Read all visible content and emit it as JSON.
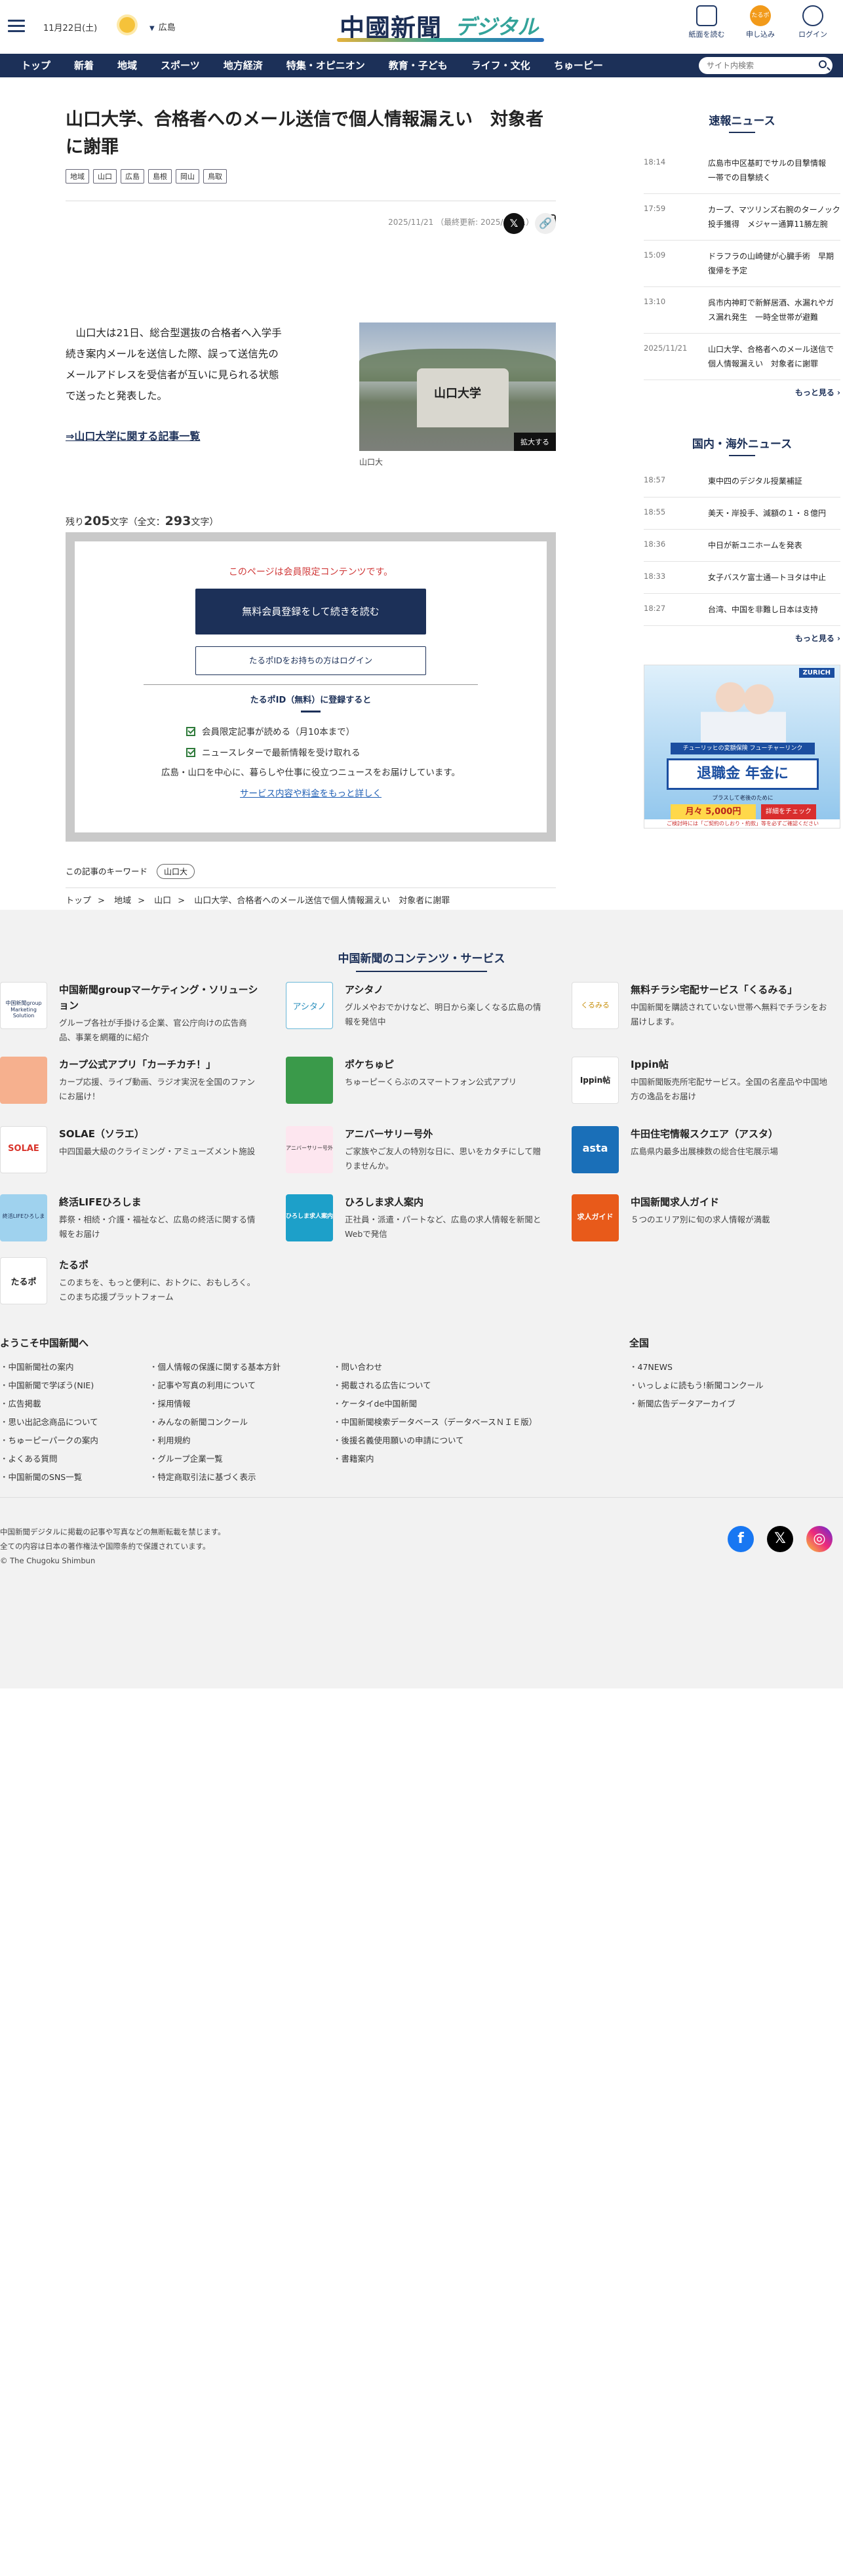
{
  "header": {
    "date": "11月22日(土)",
    "weather_icon": "sun-icon",
    "region": "広島",
    "logo_main": "中國新聞",
    "logo_sub": "デジタル",
    "btn_paper": "紙面を読む",
    "btn_apply": "申し込み",
    "btn_apply_icon": "たるポ",
    "btn_login": "ログイン"
  },
  "nav": {
    "items": [
      "トップ",
      "新着",
      "地域",
      "スポーツ",
      "地方経済",
      "特集・オピニオン",
      "教育・子ども",
      "ライフ・文化",
      "ちゅーピー"
    ],
    "search_placeholder": "サイト内検索"
  },
  "article": {
    "headline": "山口大学、合格者へのメール送信で個人情報漏えい　対象者に謝罪",
    "tags": [
      "地域",
      "山口",
      "広島",
      "島根",
      "岡山",
      "鳥取"
    ],
    "date": "2025/11/21",
    "updated": "（最終更新: 2025/11/21）",
    "lead": "　山口大は21日、総合型選抜の合格者へ入学手続き案内メールを送信した際、誤って送信先のメールアドレスを受信者が互いに見られる状態で送ったと発表した。",
    "related_link": "⇒山口大学に関する記事一覧",
    "photo_sign": "山口大学",
    "photo_expand": "拡大する",
    "photo_caption": "山口大",
    "remain_prefix": "残り",
    "remain_count": "205",
    "remain_suffix": "文字（全文：",
    "total_count": "293",
    "total_suffix": "文字）",
    "keyword_label": "この記事のキーワード",
    "keyword": "山口大"
  },
  "paywall": {
    "message": "このページは会員限定コンテンツです。",
    "primary_button": "無料会員登録をして続きを読む",
    "secondary_button": "たるポIDをお持ちの方はログイン",
    "register_title": "たるポID（無料）に登録すると",
    "benefits": [
      "会員限定記事が読める（月10本まで）",
      "ニュースレターで最新情報を受け取れる"
    ],
    "note": "広島・山口を中心に、暮らしや仕事に役立つニュースをお届けしています。",
    "more_link": "サービス内容や料金をもっと詳しく"
  },
  "breadcrumb": [
    "トップ",
    "地域",
    "山口",
    "山口大学、合格者へのメール送信で個人情報漏えい　対象者に謝罪"
  ],
  "sidebar": {
    "breaking_title": "速報ニュース",
    "breaking": [
      {
        "time": "18:14",
        "title": "広島市中区基町でサルの目撃情報　一帯での目撃続く"
      },
      {
        "time": "17:59",
        "title": "カープ、マツリンズ右腕のターノック投手獲得　メジャー通算11勝左腕"
      },
      {
        "time": "15:09",
        "title": "ドラフラの山崎健が心臓手術　早期復帰を予定"
      },
      {
        "time": "13:10",
        "title": "呉市内神町で新鮮居酒、水漏れやガス漏れ発生　一時全世帯が避難"
      },
      {
        "time": "2025/11/21",
        "title": "山口大学、合格者へのメール送信で個人情報漏えい　対象者に謝罪"
      }
    ],
    "more": "もっと見る",
    "world_title": "国内・海外ニュース",
    "world": [
      {
        "time": "18:57",
        "title": "東中四のデジタル授業補証"
      },
      {
        "time": "18:55",
        "title": "美天・岸投手、減額の１・８億円"
      },
      {
        "time": "18:36",
        "title": "中日が新ユニホームを発表"
      },
      {
        "time": "18:33",
        "title": "女子バスケ富士通—トヨタは中止"
      },
      {
        "time": "18:27",
        "title": "台湾、中国を非難し日本は支持"
      }
    ],
    "ad": {
      "brand": "ZURICH",
      "band": "チューリッヒの変額保険 フューチャーリンク",
      "headline": "退職金 年金に",
      "subline": "プラスして老後のために",
      "price": "月々 5,000円",
      "cta": "詳細をチェック",
      "fine": "ご検討時には「ご契約のしおり・約款」等を必ずご確認ください"
    }
  },
  "services": {
    "title": "中国新聞のコンテンツ・サービス",
    "items": [
      {
        "name": "中国新聞groupマーケティング・ソリューション",
        "desc": "グループ各社が手掛ける企業、官公庁向けの広告商品、事業を網羅的に紹介",
        "icon": "marketing-logo",
        "badge": "中国新聞group Marketing Solution"
      },
      {
        "name": "アシタノ",
        "desc": "グルメやおでかけなど、明日から楽しくなる広島の情報を発信中",
        "icon": "ashitano-logo",
        "badge": "アシタノ"
      },
      {
        "name": "無料チラシ宅配サービス「くるみる」",
        "desc": "中国新聞を購読されていない世帯へ無料でチラシをお届けします。",
        "icon": "kurumiru-logo",
        "badge": "くるみる"
      },
      {
        "name": "カープ公式アプリ「カーチカチ！」",
        "desc": "カープ応援、ライブ動画、ラジオ実況を全国のファンにお届け！",
        "icon": "carp-app-logo",
        "badge": ""
      },
      {
        "name": "ポケちゅピ",
        "desc": "ちゅーピーくらぶのスマートフォン公式アプリ",
        "icon": "pokechupi-logo",
        "badge": ""
      },
      {
        "name": "Ippin帖",
        "desc": "中国新聞販売所宅配サービス。全国の名産品や中国地方の逸品をお届け",
        "icon": "ippin-logo",
        "badge": "Ippin帖"
      },
      {
        "name": "SOLAE（ソラエ）",
        "desc": "中四国最大級のクライミング・アミューズメント施設",
        "icon": "solae-logo",
        "badge": "SOLAE"
      },
      {
        "name": "アニバーサリー号外",
        "desc": "ご家族やご友人の特別な日に、思いをカタチにして贈りませんか。",
        "icon": "anniversary-logo",
        "badge": "アニバーサリー号外"
      },
      {
        "name": "牛田住宅情報スクエア（アスタ）",
        "desc": "広島県内最多出展棟数の総合住宅展示場",
        "icon": "asta-logo",
        "badge": "asta"
      },
      {
        "name": "終活LIFEひろしま",
        "desc": "葬祭・相続・介護・福祉など、広島の終活に関する情報をお届け",
        "icon": "shukatsu-logo",
        "badge": "終活LIFEひろしま"
      },
      {
        "name": "ひろしま求人案内",
        "desc": "正社員・派遣・パートなど、広島の求人情報を新聞とWebで発信",
        "icon": "kyujin-logo",
        "badge": "ひろしま求人案内"
      },
      {
        "name": "中国新聞求人ガイド",
        "desc": "５つのエリア別に旬の求人情報が満載",
        "icon": "kyujin-guide-logo",
        "badge": "求人ガイド"
      },
      {
        "name": "たるポ",
        "desc": "このまちを、もっと便利に、おトクに、おもしろく。このまち応援プラットフォーム",
        "icon": "tarupo-logo",
        "badge": "たるポ"
      }
    ]
  },
  "footer": {
    "welcome_title": "ようこそ中国新聞へ",
    "national_title": "全国",
    "col1": [
      "中国新聞社の案内",
      "中国新聞で学ぼう(NIE)",
      "広告掲載",
      "思い出記念商品について",
      "ちゅーピーパークの案内",
      "よくある質問",
      "中国新聞のSNS一覧"
    ],
    "col2": [
      "個人情報の保護に関する基本方針",
      "記事や写真の利用について",
      "採用情報",
      "みんなの新聞コンクール",
      "利用規約",
      "グループ企業一覧",
      "特定商取引法に基づく表示"
    ],
    "col3": [
      "問い合わせ",
      "掲載される広告について",
      "ケータイde中国新聞",
      "中国新聞検索データベース（データベースＮＩＥ版）",
      "後援名義使用願いの申請について",
      "書籍案内"
    ],
    "col4": [
      "47NEWS",
      "いっしょに読もう!新聞コンクール",
      "新聞広告データアーカイブ"
    ],
    "copyright_lines": [
      "中国新聞デジタルに掲載の記事や写真などの無断転載を禁じます。",
      "全ての内容は日本の著作権法や国際条約で保護されています。",
      "© The Chugoku Shimbun"
    ],
    "sns": [
      "facebook-icon",
      "x-icon",
      "instagram-icon"
    ]
  },
  "colors": {
    "nav_bg": "#1c3058",
    "accent_red": "#d03a3a",
    "link_blue": "#1f5fb5",
    "footer_bg": "#f2f2f2"
  }
}
